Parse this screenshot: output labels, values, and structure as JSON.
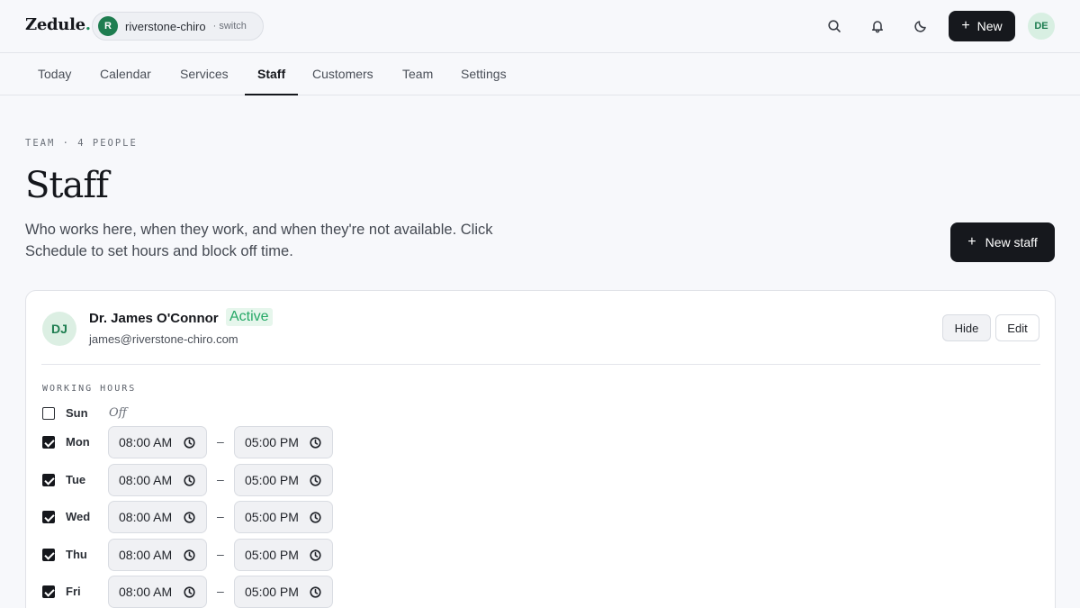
{
  "app": {
    "brand_name": "Zedule",
    "brand_dot": "."
  },
  "workspace": {
    "avatar_letter": "R",
    "name": "riverstone-chiro",
    "switch_label": "· switch"
  },
  "header": {
    "new_label": "New",
    "user_initials": "DE",
    "icons": [
      "search-icon",
      "bell-icon",
      "moon-icon",
      "plus-icon"
    ]
  },
  "nav": {
    "tabs": [
      {
        "label": "Today",
        "active": false
      },
      {
        "label": "Calendar",
        "active": false
      },
      {
        "label": "Services",
        "active": false
      },
      {
        "label": "Staff",
        "active": true
      },
      {
        "label": "Customers",
        "active": false
      },
      {
        "label": "Team",
        "active": false
      },
      {
        "label": "Settings",
        "active": false
      }
    ]
  },
  "page": {
    "eyebrow": "TEAM · 4 PEOPLE",
    "title": "Staff",
    "description": "Who works here, when they work, and when they're not available. Click Schedule to set hours and block off time.",
    "new_staff_label": "New staff"
  },
  "staff": [
    {
      "initials": "DJ",
      "name": "Dr. James O'Connor",
      "status": "Active",
      "email": "james@riverstone-chiro.com",
      "hide_label": "Hide",
      "edit_label": "Edit",
      "working_hours_label": "WORKING HOURS",
      "days": [
        {
          "day": "Sun",
          "enabled": false,
          "off_label": "Off"
        },
        {
          "day": "Mon",
          "enabled": true,
          "start": "08:00 AM",
          "end": "05:00 PM"
        },
        {
          "day": "Tue",
          "enabled": true,
          "start": "08:00 AM",
          "end": "05:00 PM"
        },
        {
          "day": "Wed",
          "enabled": true,
          "start": "08:00 AM",
          "end": "05:00 PM"
        },
        {
          "day": "Thu",
          "enabled": true,
          "start": "08:00 AM",
          "end": "05:00 PM"
        },
        {
          "day": "Fri",
          "enabled": true,
          "start": "08:00 AM",
          "end": "05:00 PM"
        }
      ],
      "time_separator": "–"
    }
  ],
  "colors": {
    "accent": "#1e7d50",
    "primary_button": "#16181d",
    "active_badge": "#25a866"
  }
}
